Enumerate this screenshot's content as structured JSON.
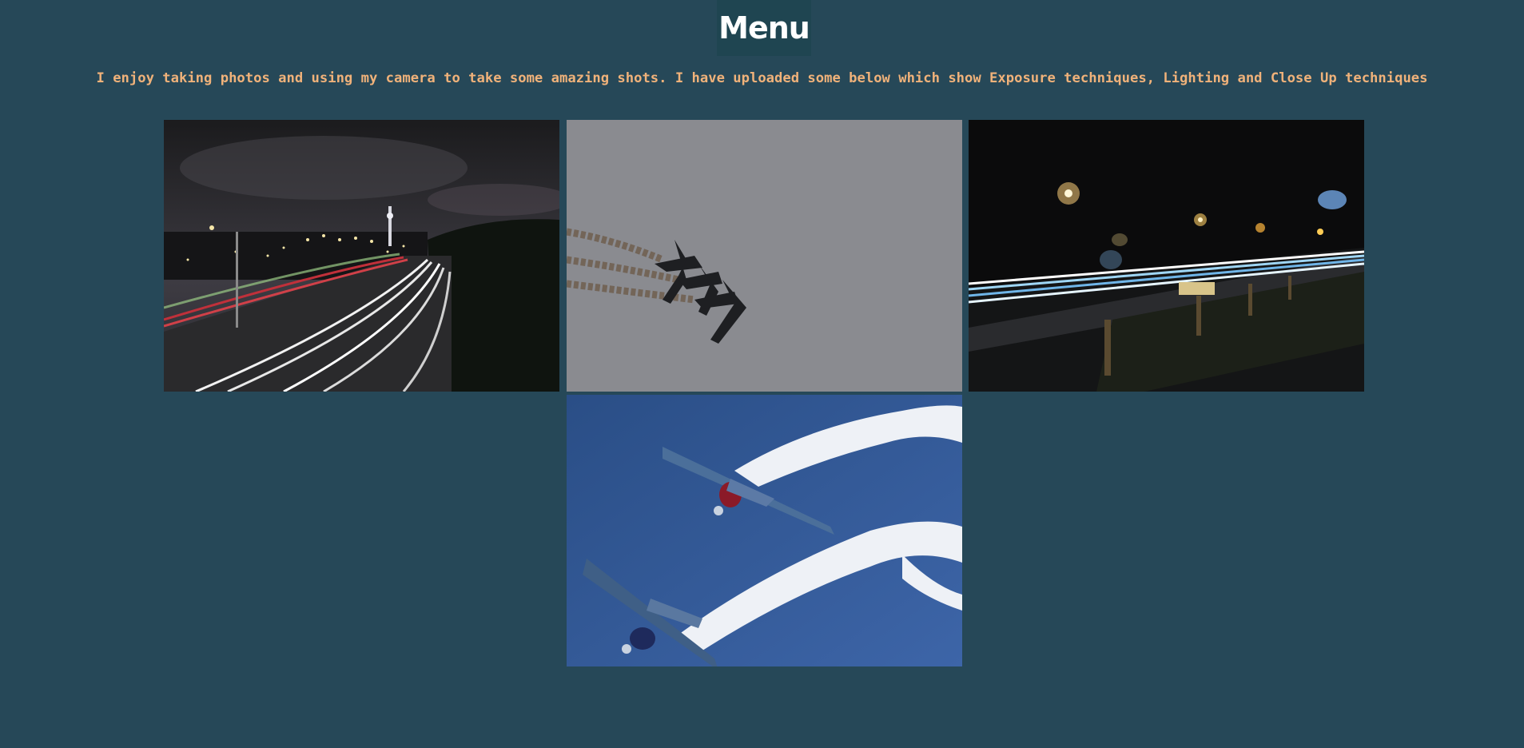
{
  "header": {
    "menu_label": "Menu"
  },
  "intro": {
    "text": "I enjoy taking photos and using my camera to take some amazing shots. I have uploaded some below which show Exposure techniques, Lighting and Close Up techniques"
  },
  "colors": {
    "background": "#264858",
    "menu_background": "#1f4551",
    "menu_text": "#ffffff",
    "intro_text": "#f0b27a"
  },
  "gallery": {
    "photos": [
      {
        "name": "city-highway-light-trails-photo"
      },
      {
        "name": "three-planes-smoke-trails-photo"
      },
      {
        "name": "night-road-light-streaks-photo"
      },
      {
        "name": "two-aerobatic-planes-photo"
      }
    ]
  }
}
